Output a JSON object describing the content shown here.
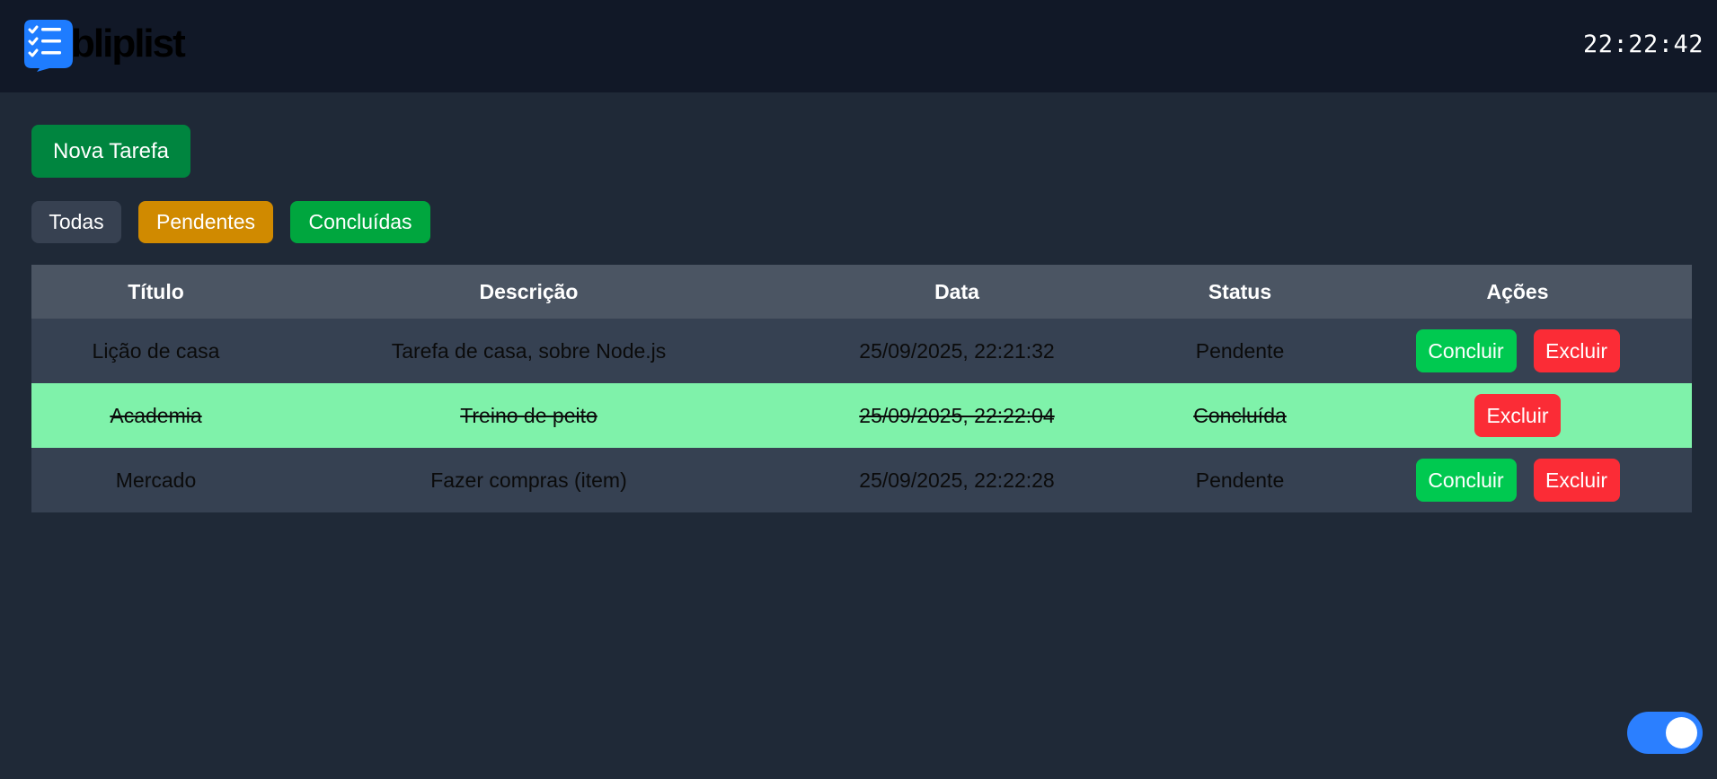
{
  "app": {
    "logo_text": "bliplist",
    "clock": "22:22:42",
    "colors": {
      "topbar": "#111827",
      "background": "#1f2937",
      "logo_blue": "#1e7cff",
      "primary_green": "#00853f",
      "pending_amber": "#d08a00",
      "done_green": "#00a63e",
      "conclude_green": "#00c950",
      "delete_red": "#fb2c36",
      "done_row": "#7ff2aa",
      "toggle_blue": "#2b7fff"
    }
  },
  "toolbar": {
    "new_task_label": "Nova Tarefa"
  },
  "filters": {
    "all": "Todas",
    "pending": "Pendentes",
    "done": "Concluídas"
  },
  "table": {
    "headers": {
      "title": "Título",
      "description": "Descrição",
      "date": "Data",
      "status": "Status",
      "actions": "Ações"
    },
    "rows": [
      {
        "title": "Lição de casa",
        "description": "Tarefa de casa, sobre Node.js",
        "date": "25/09/2025, 22:21:32",
        "status": "Pendente",
        "conclude_label": "Concluir",
        "delete_label": "Excluir"
      },
      {
        "title": "Academia",
        "description": "Treino de peito",
        "date": "25/09/2025, 22:22:04",
        "status": "Concluída",
        "delete_label": "Excluir"
      },
      {
        "title": "Mercado",
        "description": "Fazer compras (item)",
        "date": "25/09/2025, 22:22:28",
        "status": "Pendente",
        "conclude_label": "Concluir",
        "delete_label": "Excluir"
      }
    ]
  },
  "theme_toggle": {
    "icon": "toggle-switch-icon",
    "state": "on"
  }
}
